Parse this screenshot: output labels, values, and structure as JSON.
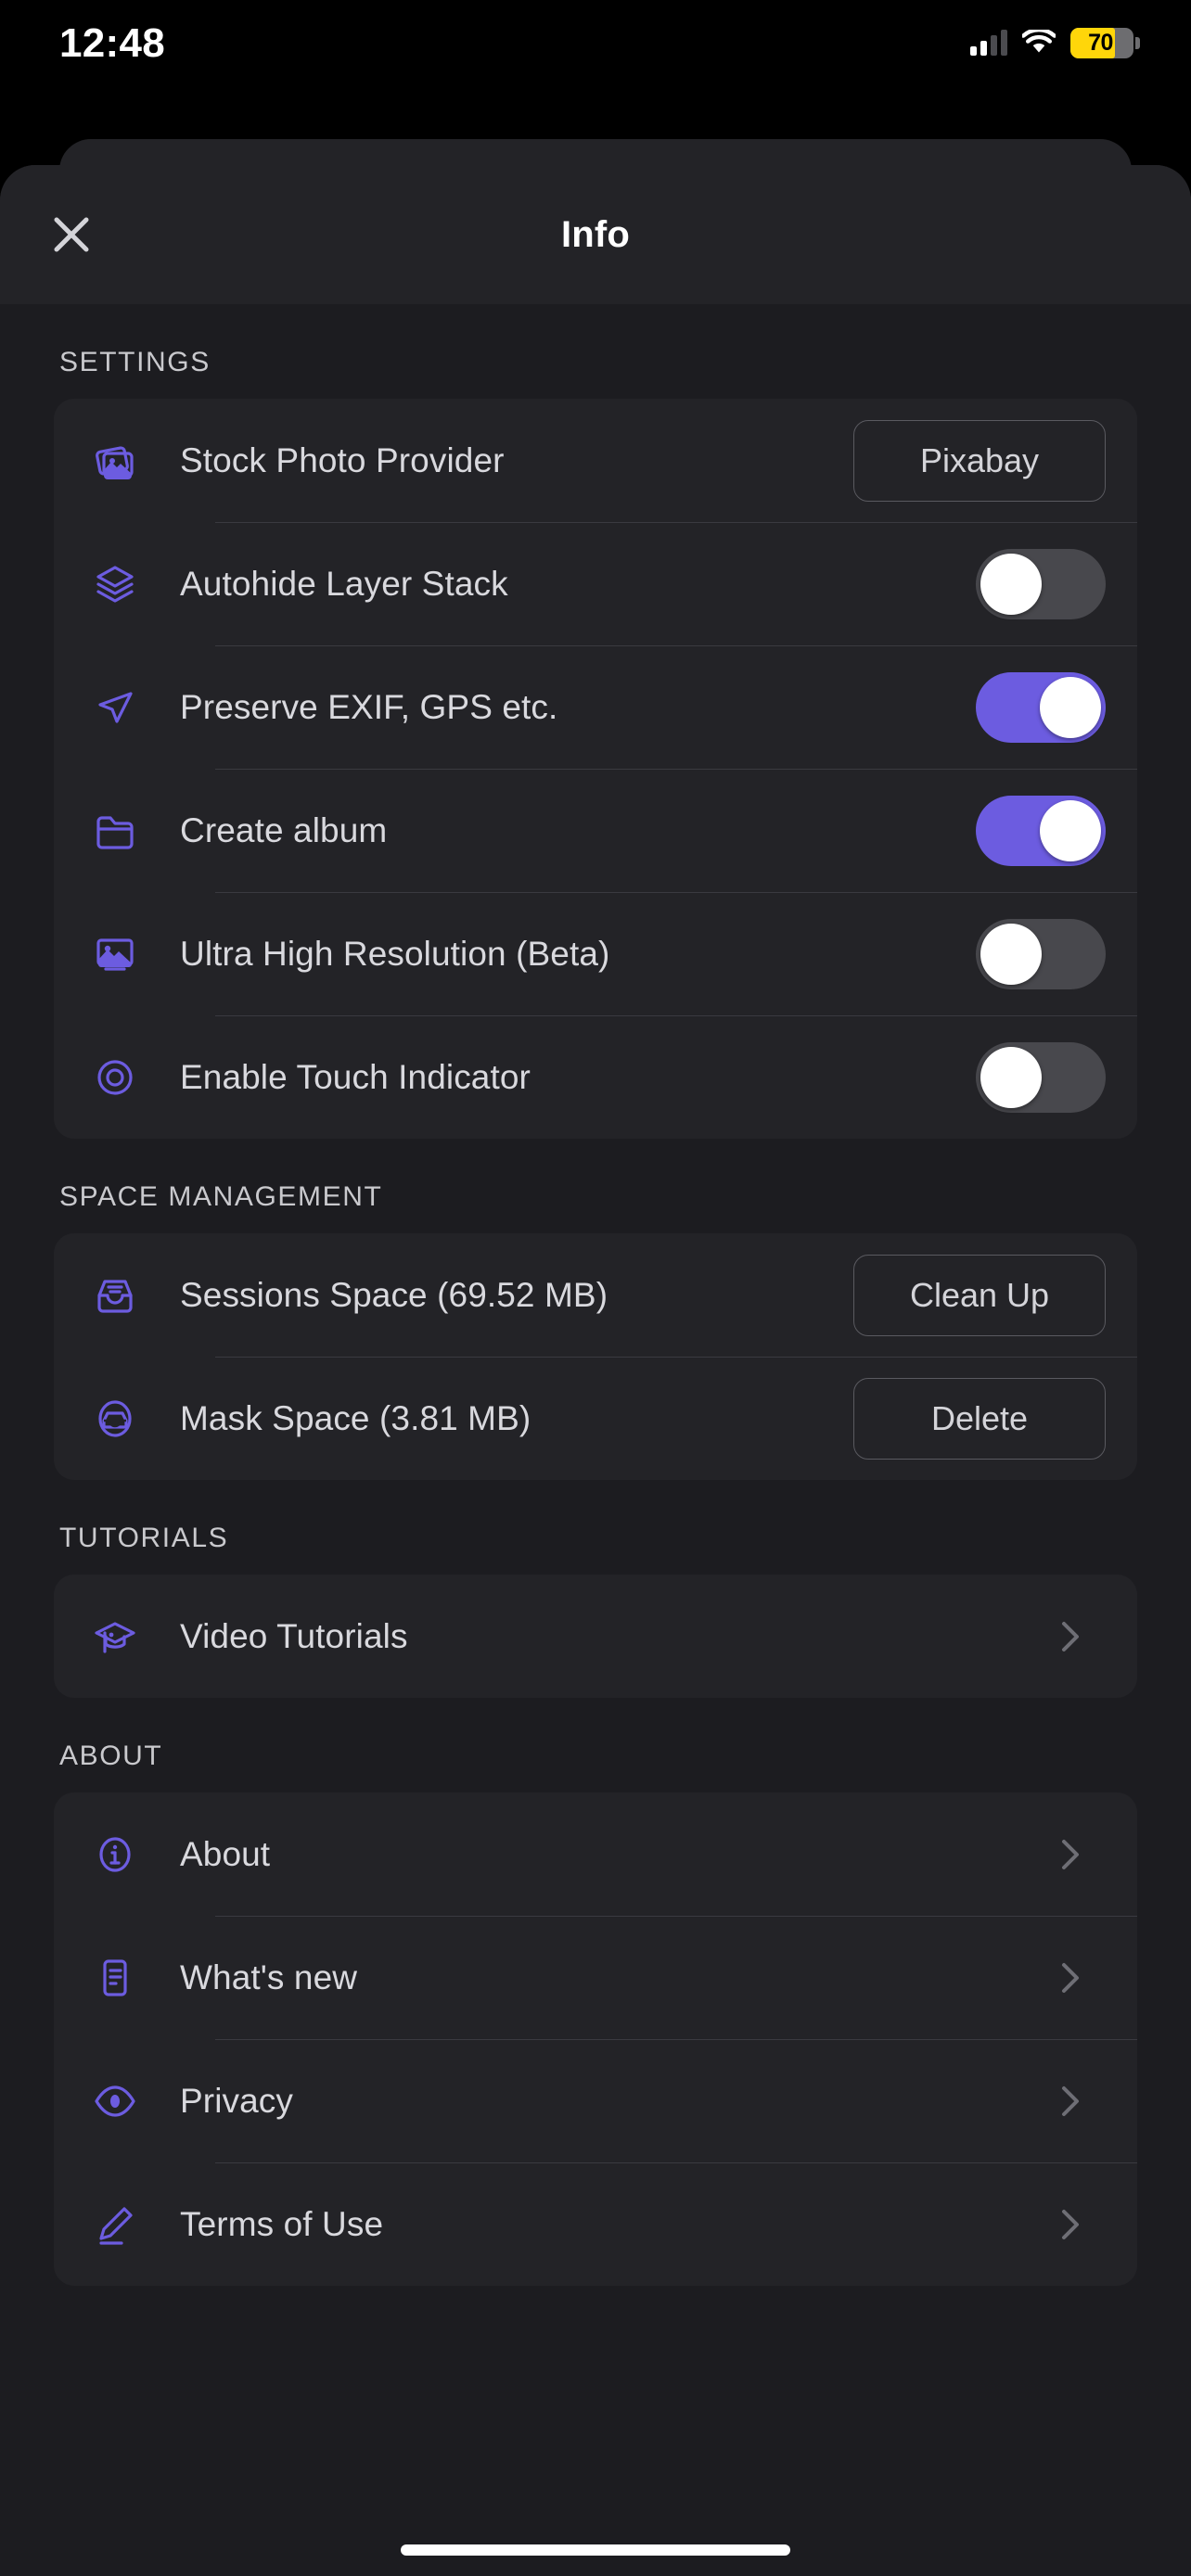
{
  "status_bar": {
    "time": "12:48",
    "battery_percent": "70",
    "battery_level": 70,
    "battery_color": "#FFD60A",
    "signal_icon": "cellular-signal-icon",
    "wifi_icon": "wifi-icon",
    "battery_icon": "battery-icon"
  },
  "nav": {
    "title": "Info",
    "close_icon": "close-icon"
  },
  "accent_color": "#6C5CE0",
  "sections": [
    {
      "label": "SETTINGS",
      "rows": [
        {
          "icon": "stock-photos-icon",
          "label": "Stock Photo Provider",
          "control": "pill",
          "value": "Pixabay"
        },
        {
          "icon": "layers-icon",
          "label": "Autohide Layer Stack",
          "control": "toggle",
          "value": "off"
        },
        {
          "icon": "navigation-arrow-icon",
          "label": "Preserve EXIF, GPS etc.",
          "control": "toggle",
          "value": "on"
        },
        {
          "icon": "folder-icon",
          "label": "Create album",
          "control": "toggle",
          "value": "on"
        },
        {
          "icon": "image-icon",
          "label": "Ultra High Resolution (Beta)",
          "control": "toggle",
          "value": "off"
        },
        {
          "icon": "touch-indicator-icon",
          "label": "Enable Touch Indicator",
          "control": "toggle",
          "value": "off"
        }
      ]
    },
    {
      "label": "SPACE MANAGEMENT",
      "rows": [
        {
          "icon": "inbox-icon",
          "label": "Sessions Space (69.52 MB)",
          "control": "pill",
          "value": "Clean Up"
        },
        {
          "icon": "mask-inbox-icon",
          "label": "Mask Space (3.81 MB)",
          "control": "pill",
          "value": "Delete"
        }
      ]
    },
    {
      "label": "TUTORIALS",
      "rows": [
        {
          "icon": "graduation-cap-icon",
          "label": "Video Tutorials",
          "control": "chevron",
          "value": "chevron-right-icon"
        }
      ]
    },
    {
      "label": "ABOUT",
      "rows": [
        {
          "icon": "info-circle-icon",
          "label": "About",
          "control": "chevron",
          "value": "chevron-right-icon"
        },
        {
          "icon": "changelog-icon",
          "label": "What's new",
          "control": "chevron",
          "value": "chevron-right-icon"
        },
        {
          "icon": "eye-icon",
          "label": "Privacy",
          "control": "chevron",
          "value": "chevron-right-icon"
        },
        {
          "icon": "pencil-icon",
          "label": "Terms of Use",
          "control": "chevron",
          "value": "chevron-right-icon"
        }
      ]
    }
  ]
}
